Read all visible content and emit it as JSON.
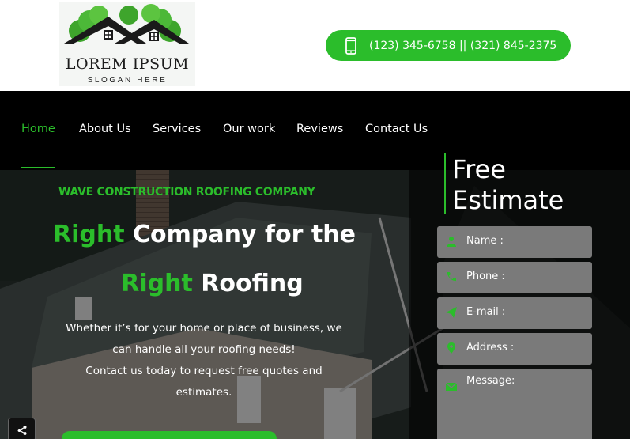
{
  "header": {
    "logo_title": "LOREM IPSUM",
    "logo_slogan": "SLOGAN HERE",
    "phone_text": "(123) 345-6758 || (321) 845-2375",
    "phone_icon": "mobile-phone-icon"
  },
  "nav": {
    "items": [
      {
        "label": "Home",
        "active": true
      },
      {
        "label": "About Us"
      },
      {
        "label": "Services"
      },
      {
        "label": "Our work"
      },
      {
        "label": "Reviews"
      },
      {
        "label": "Contact Us"
      }
    ]
  },
  "hero": {
    "eyebrow": "WAVE CONSTRUCTION ROOFING COMPANY",
    "headline_line1_green": "Right",
    "headline_line1_rest": " Company for the",
    "headline_line2_green": "Right",
    "headline_line2_rest": " Roofing",
    "copy_line1": "Whether it’s for your home or place of business, we",
    "copy_line2": "can handle all your roofing needs!",
    "copy_line3": "Contact us today to request free quotes and",
    "copy_line4": "estimates."
  },
  "estimate": {
    "title_line1": "Free",
    "title_line2": "Estimate",
    "fields": [
      {
        "label": "Name :",
        "icon": "user-icon"
      },
      {
        "label": "Phone :",
        "icon": "phone-icon"
      },
      {
        "label": "E-mail :",
        "icon": "send-icon"
      },
      {
        "label": "Address :",
        "icon": "map-pin-icon"
      },
      {
        "label": "Message:",
        "icon": "envelope-icon"
      }
    ]
  },
  "colors": {
    "accent": "#2bbd2b",
    "nav_bg": "#000000",
    "field_bg": "#7a7a7a"
  },
  "share": {
    "icon": "share-icon"
  }
}
